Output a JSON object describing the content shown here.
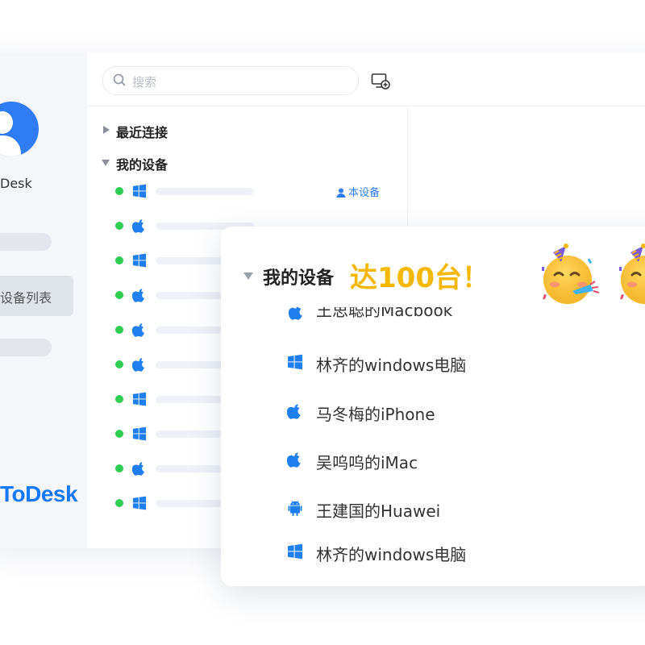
{
  "sidebar": {
    "brand_small": "Desk",
    "active_item": "设备列表",
    "brand_big": "ToDesk"
  },
  "search": {
    "placeholder": "搜索"
  },
  "tree": {
    "recent": "最近连接",
    "my_devices": "我的设备",
    "this_device": "本设备",
    "devices": [
      {
        "os": "windows",
        "online": true
      },
      {
        "os": "apple",
        "online": true
      },
      {
        "os": "windows",
        "online": true
      },
      {
        "os": "apple",
        "online": true
      },
      {
        "os": "apple",
        "online": true
      },
      {
        "os": "apple",
        "online": true
      },
      {
        "os": "windows",
        "online": true
      },
      {
        "os": "windows",
        "online": true
      },
      {
        "os": "apple",
        "online": true
      },
      {
        "os": "windows",
        "online": true
      }
    ]
  },
  "card": {
    "title": "我的设备",
    "accent": "达100台！",
    "clipped_item": {
      "label": "王思聪的Macbook",
      "icon": "apple-icon"
    },
    "items": [
      {
        "label": "林齐的windows电脑",
        "icon": "windows-icon"
      },
      {
        "label": "马冬梅的iPhone",
        "icon": "apple-icon"
      },
      {
        "label": "吴呜呜的iMac",
        "icon": "apple-icon"
      },
      {
        "label": "王建国的Huawei",
        "icon": "android-icon"
      },
      {
        "label": "林齐的windows电脑",
        "icon": "windows-icon"
      }
    ]
  },
  "colors": {
    "accent_blue": "#2f7cf6",
    "online_green": "#2fcd52",
    "celebration_yellow": "#f5b800"
  }
}
